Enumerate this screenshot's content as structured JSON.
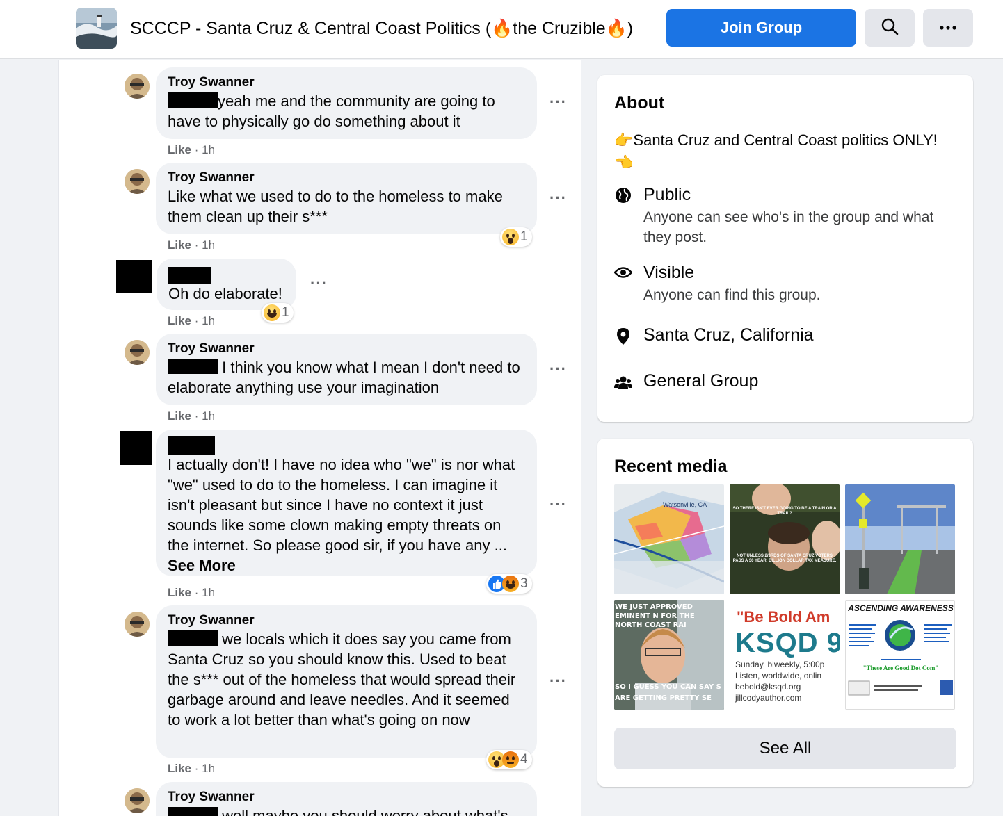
{
  "header": {
    "group_title": "SCCCP - Santa Cruz & Central Coast Politics (🔥the Cruzible🔥)",
    "join_label": "Join Group"
  },
  "comments": [
    {
      "author": "Troy Swanner",
      "text": "yeah me and the community are going to have to physically go do something about it",
      "like": "Like",
      "time": "· 1h"
    },
    {
      "author": "Troy Swanner",
      "text": "Like what we used to do to the homeless to make them clean up their s***",
      "like": "Like",
      "time": "· 1h",
      "reactions": "1"
    },
    {
      "author": "",
      "text": "Oh do elaborate!",
      "like": "Like",
      "time": "· 1h",
      "reactions": "1"
    },
    {
      "author": "Troy Swanner",
      "text": "I think you know what I mean I don't need to elaborate anything use your imagination",
      "like": "Like",
      "time": "· 1h"
    },
    {
      "author": "",
      "text": "I actually don't! I have no idea who \"we\" is nor what \"we\" used to do to the homeless. I can imagine it isn't pleasant but since I have no context it just sounds like some clown making empty threats on the internet. So please good sir, if you have any ...",
      "see_more": "See More",
      "like": "Like",
      "time": "· 1h",
      "reactions": "3"
    },
    {
      "author": "Troy Swanner",
      "text": "we locals which it does say you came from Santa Cruz so you should know this. Used to beat the s*** out of the homeless that would spread their garbage around and leave needles. And it seemed to work a lot better than what's going on now",
      "like": "Like",
      "time": "· 1h",
      "reactions": "4"
    },
    {
      "author": "Troy Swanner",
      "text": "well maybe you should worry about what's"
    }
  ],
  "about": {
    "heading": "About",
    "description": "Santa Cruz and Central Coast politics ONLY!",
    "public_title": "Public",
    "public_sub": "Anyone can see who's in the group and what they post.",
    "visible_title": "Visible",
    "visible_sub": "Anyone can find this group.",
    "location": "Santa Cruz, California",
    "group_type": "General Group"
  },
  "media": {
    "heading": "Recent media",
    "thumb_texts": {
      "map_label": "Watsonville, CA",
      "meme1_top": "SO THERE ISN'T EVER GOING TO BE A TRAIN OR A TRAIL?",
      "meme1_bottom": "NOT UNLESS 2/3RDS OF SANTA CRUZ VOTERS PASS A 30 YEAR, BILLION DOLLAR TAX MEASURE.",
      "meme2_top": "WE JUST APPROVED EMINENT N FOR THE NORTH COAST RAI",
      "meme2_bottom": "SO I GUESS YOU CAN SAY S ARE GETTING PRETTY SE",
      "ksqd_line1": "\"Be Bold Am",
      "ksqd_line2": "KSQD 9",
      "ksqd_line3": "Sunday, biweekly, 5:00p",
      "ksqd_line4": "Listen, worldwide, onlin",
      "ksqd_line5": "bebold@ksqd.org",
      "ksqd_line6": "jillcodyauthor.com",
      "aa_title": "ASCENDING AWARENESS",
      "aa_link": "\"These Are Good Dot Com\""
    },
    "see_all": "See All"
  },
  "icons": [
    "search-icon",
    "more-icon",
    "globe-icon",
    "eye-icon",
    "location-pin-icon",
    "people-icon",
    "pointing-right-icon",
    "pointing-left-icon",
    "wow-reaction-icon",
    "haha-reaction-icon",
    "like-reaction-icon",
    "angry-reaction-icon"
  ]
}
